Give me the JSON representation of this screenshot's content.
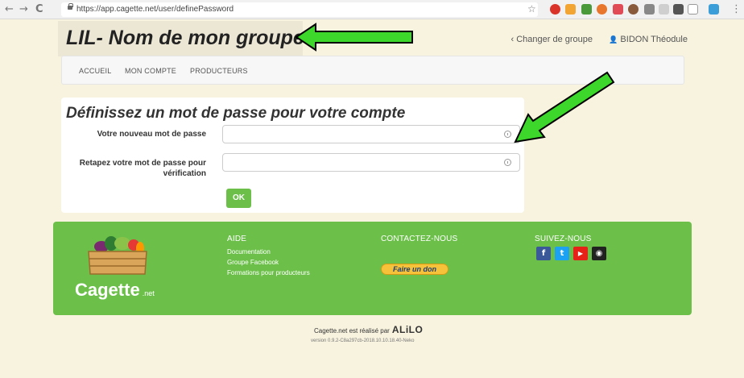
{
  "browser": {
    "url": "https://app.cagette.net/user/definePassword",
    "back_glyph": "←",
    "forward_glyph": "→",
    "reload_glyph": "C",
    "star_glyph": "☆",
    "menu_glyph": "⋮",
    "extension_icons": [
      "abp-icon",
      "extension-icon",
      "extension-icon",
      "extension-icon",
      "pocket-icon",
      "extension-icon",
      "extension-icon",
      "extension-icon",
      "extension-icon",
      "amazon-icon",
      "extension-icon"
    ]
  },
  "header": {
    "group_title_prefix": "LIL",
    "group_title_rest": "- Nom de mon groupe",
    "change_group": "Changer de groupe",
    "change_group_glyph": "‹",
    "user_glyph": "👤",
    "user_name": "BIDON Théodule"
  },
  "nav": {
    "items": [
      "ACCUEIL",
      "MON COMPTE",
      "PRODUCTEURS"
    ]
  },
  "form": {
    "title": "Définissez un mot de passe pour votre compte",
    "label_new": "Votre nouveau mot de passe",
    "label_confirm": "Retapez votre mot de passe pour vérification",
    "value_new": "",
    "value_confirm": "",
    "submit": "OK"
  },
  "footer": {
    "brand": "Cagette",
    "brand_suffix": ".net",
    "aide_title": "AIDE",
    "aide_links": [
      "Documentation",
      "Groupe Facebook",
      "Formations pour producteurs"
    ],
    "contact_title": "CONTACTEZ-NOUS",
    "donate": "Faire un don",
    "follow_title": "SUIVEZ-NOUS",
    "social": [
      {
        "name": "facebook-icon",
        "glyph": "f",
        "color": "#3b5998"
      },
      {
        "name": "twitter-icon",
        "glyph": "t",
        "color": "#1da1f2"
      },
      {
        "name": "youtube-icon",
        "glyph": "▶",
        "color": "#e62117"
      },
      {
        "name": "github-icon",
        "glyph": "◉",
        "color": "#222222"
      }
    ],
    "made_by": "Cagette.net est réalisé par",
    "made_by_brand": "ALiLO",
    "version": "version 0.9.2-C8a297cb-2018.10.10.18.40-Neko"
  },
  "colors": {
    "accent": "#6cc04a",
    "background": "#f8f3df",
    "arrow": "#3dd62a"
  }
}
